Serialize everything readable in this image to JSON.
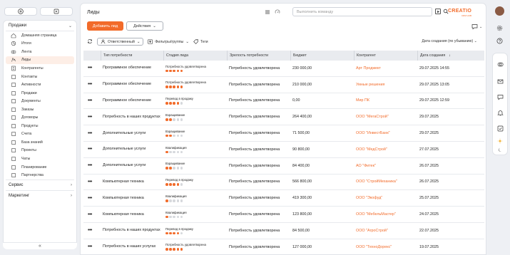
{
  "sidebar": {
    "section_sales": "Продажи",
    "items": [
      {
        "label": "Домашняя страница",
        "icon": "home-icon"
      },
      {
        "label": "Итоги",
        "icon": "chart-icon"
      },
      {
        "label": "Лента",
        "icon": "feed-icon"
      },
      {
        "label": "Лиды",
        "icon": "lead-icon",
        "active": true
      },
      {
        "label": "Контрагенты",
        "icon": "building-icon"
      },
      {
        "label": "Контакты",
        "icon": "contacts-icon"
      },
      {
        "label": "Активности",
        "icon": "activity-icon"
      },
      {
        "label": "Продажи",
        "icon": "sales-icon"
      },
      {
        "label": "Документы",
        "icon": "documents-icon"
      },
      {
        "label": "Заказы",
        "icon": "orders-icon"
      },
      {
        "label": "Договоры",
        "icon": "contracts-icon"
      },
      {
        "label": "Продукты",
        "icon": "products-icon"
      },
      {
        "label": "Счета",
        "icon": "invoices-icon"
      },
      {
        "label": "База знаний",
        "icon": "knowledge-icon"
      },
      {
        "label": "Проекты",
        "icon": "projects-icon"
      },
      {
        "label": "Чаты",
        "icon": "chats-icon"
      },
      {
        "label": "Планирование",
        "icon": "planning-icon"
      },
      {
        "label": "Партнерства",
        "icon": "partners-icon"
      }
    ],
    "section_service": "Сервис",
    "section_marketing": "Маркетинг"
  },
  "header": {
    "title": "Лиды",
    "command_placeholder": "Выполнить команду",
    "logo": "CREATIO",
    "logo_sub": "CRM HUB"
  },
  "toolbar": {
    "add_label": "Добавить лид",
    "actions_label": "Действия",
    "responsible_label": "Ответственный",
    "filters_label": "Фильтры/группы",
    "tags_label": "Теги",
    "sort_label": "Дата создания (по убыванию)"
  },
  "table": {
    "columns": [
      "Тип потребности",
      "Стадия лида",
      "Зрелость потребности",
      "Бюджет",
      "Контрагент",
      "Дата создания"
    ],
    "rows": [
      {
        "need": "Программное обеспечение",
        "stage": "Потребность удовлетворена",
        "stage_level": 5,
        "maturity": "Потребность удовлетворена",
        "budget": "230 000,00",
        "account": "Арт Проджект",
        "date": "29.07.2025 14:55"
      },
      {
        "need": "Программное обеспечение",
        "stage": "Потребность удовлетворена",
        "stage_level": 5,
        "maturity": "Потребность удовлетворена",
        "budget": "210 000,00",
        "account": "Умные решения",
        "date": "29.07.2025 13:05"
      },
      {
        "need": "Программное обеспечение",
        "stage": "Перевод в продажу",
        "stage_level": 4,
        "maturity": "Потребность удовлетворена",
        "budget": "0,00",
        "account": "Мир ПК",
        "date": "29.07.2025 12:59"
      },
      {
        "need": "Потребность в наших продуктах",
        "stage": "Взращивание",
        "stage_level": 2,
        "maturity": "Потребность удовлетворена",
        "budget": "264 400,00",
        "account": "ООО \"МегаСтрой\"",
        "date": "29.07.2025"
      },
      {
        "need": "Дополнительные услуги",
        "stage": "Взращивание",
        "stage_level": 2,
        "maturity": "Потребность удовлетворена",
        "budget": "71 500,00",
        "account": "ООО \"ИнвестБанк\"",
        "date": "29.07.2025"
      },
      {
        "need": "Дополнительные услуги",
        "stage": "Квалификация",
        "stage_level": 1,
        "maturity": "Потребность удовлетворена",
        "budget": "90 800,00",
        "account": "ООО \"МедСтрой\"",
        "date": "27.07.2025"
      },
      {
        "need": "Дополнительные услуги",
        "stage": "Взращивание",
        "stage_level": 2,
        "maturity": "Потребность удовлетворена",
        "budget": "84 400,00",
        "account": "АО \"Фитек\"",
        "date": "26.07.2025"
      },
      {
        "need": "Компьютерная техника",
        "stage": "Перевод в продажу",
        "stage_level": 4,
        "maturity": "Потребность удовлетворена",
        "budget": "566 800,00",
        "account": "ООО \"СтройМеханика\"",
        "date": "26.07.2025"
      },
      {
        "need": "Компьютерная техника",
        "stage": "Квалификация",
        "stage_level": 1,
        "maturity": "Потребность удовлетворена",
        "budget": "419 300,00",
        "account": "ООО \"Экофуд\"",
        "date": "25.07.2025"
      },
      {
        "need": "Компьютерная техника",
        "stage": "Квалификация",
        "stage_level": 1,
        "maturity": "Потребность удовлетворена",
        "budget": "123 800,00",
        "account": "ООО \"МебельМастер\"",
        "date": "24.07.2025"
      },
      {
        "need": "Потребность в наших продуктах",
        "stage": "Перевод в продажу",
        "stage_level": 4,
        "maturity": "Потребность удовлетворена",
        "budget": "84 500,00",
        "account": "ООО \"АгроСтрой\"",
        "date": "22.07.2025"
      },
      {
        "need": "Потребность в наших услугах",
        "stage": "Потребность удовлетворена",
        "stage_level": 5,
        "maturity": "Потребность удовлетворена",
        "budget": "127 000,00",
        "account": "ООО \"ТехноДорекс\"",
        "date": "19.07.2025"
      }
    ]
  },
  "colors": {
    "accent": "#f26b2a",
    "dot_inactive": "#d6d8dc"
  }
}
